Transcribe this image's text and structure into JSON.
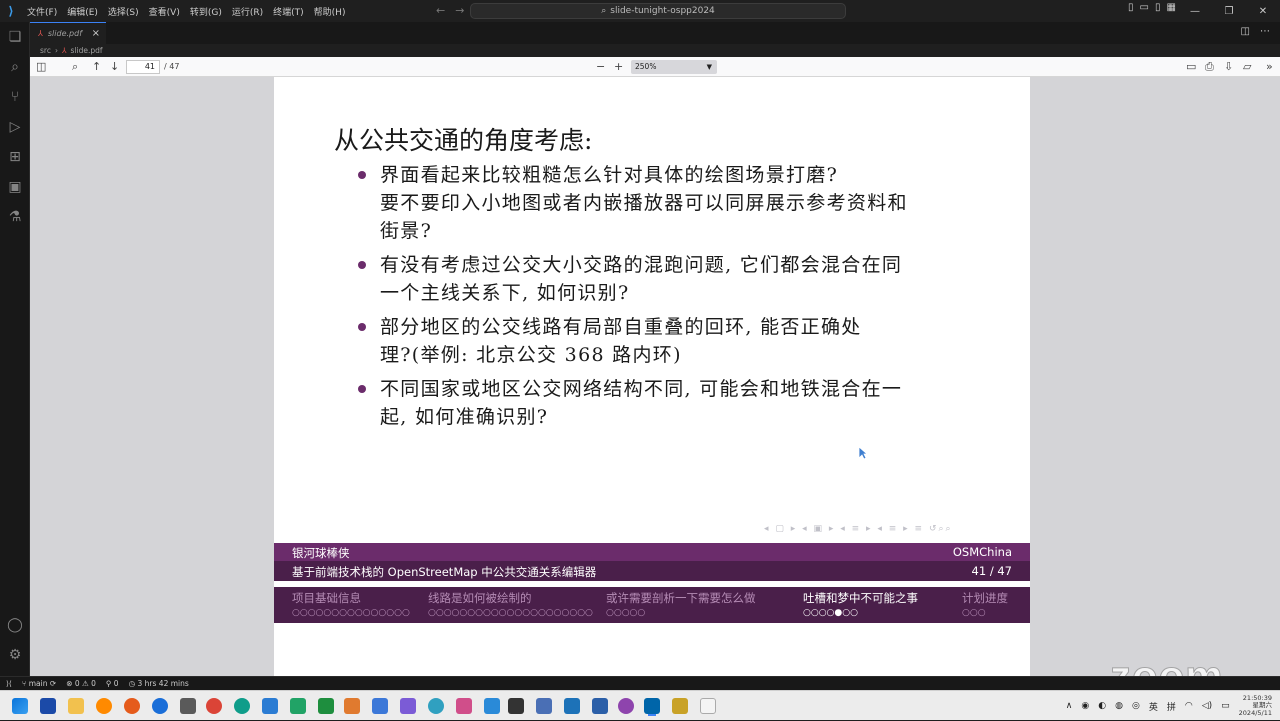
{
  "titlebar": {
    "menus": [
      "文件(F)",
      "编辑(E)",
      "选择(S)",
      "查看(V)",
      "转到(G)",
      "运行(R)",
      "终端(T)",
      "帮助(H)"
    ],
    "command_center": "slide-tunight-ospp2024"
  },
  "tab": {
    "label": "slide.pdf"
  },
  "breadcrumb": {
    "folder": "src",
    "file": "slide.pdf"
  },
  "pdf_toolbar": {
    "page_number": "41",
    "page_total": "/ 47",
    "zoom": "250%"
  },
  "slide": {
    "title": "从公共交通的角度考虑:",
    "bullets": [
      "界面看起来比较粗糙怎么针对具体的绘图场景打磨?\n要不要印入小地图或者内嵌播放器可以同屏展示参考资料和\n街景?",
      "有没有考虑过公交大小交路的混跑问题, 它们都会混合在同\n一个主线关系下, 如何识别?",
      "部分地区的公交线路有局部自重叠的回环, 能否正确处\n理?(举例: 北京公交 368 路内环)",
      "不同国家或地区公交网络结构不同, 可能会和地铁混合在一\n起, 如何准确识别?"
    ],
    "footer": {
      "author": "银河球棒侠",
      "institute": "OSMChina",
      "talk_title": "基于前端技术栈的 OpenStreetMap 中公共交通关系编辑器",
      "page": "41 / 47"
    },
    "sections": [
      {
        "label": "项目基础信息",
        "dots": "○○○○○○○○○○○○○○○"
      },
      {
        "label": "线路是如何被绘制的",
        "dots": "○○○○○○○○○○○○○○○○○○○○○"
      },
      {
        "label": "或许需要剖析一下需要怎么做",
        "dots": "○○○○○"
      },
      {
        "label": "吐槽和梦中不可能之事",
        "dots": "○○○○●○○"
      },
      {
        "label": "计划进度",
        "dots": "○○○"
      }
    ]
  },
  "statusbar": {
    "branch": "main",
    "problems": "⊗ 0 ⚠ 0",
    "ports": "0",
    "time_spent": "3 hrs 42 mins"
  },
  "watermark": "zoom",
  "taskbar": {
    "ime_lang": "英",
    "ime_mode": "拼",
    "time": "21:50:39",
    "weekday": "星期六",
    "date": "2024/5/11"
  },
  "colors": {
    "beamer_purple": "#6b2c6b",
    "beamer_dark": "#4a1f4a",
    "vscode_bg": "#1e1e1e"
  }
}
